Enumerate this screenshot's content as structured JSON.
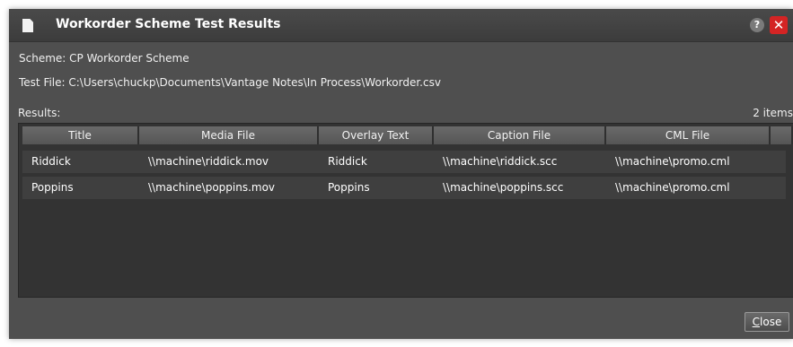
{
  "window": {
    "title": "Workorder Scheme Test Results",
    "help_icon": "?",
    "close_icon": "✕"
  },
  "info": {
    "scheme": "Scheme: CP Workorder Scheme",
    "test_file": "Test File: C:\\Users\\chuckp\\Documents\\Vantage Notes\\In Process\\Workorder.csv"
  },
  "results": {
    "label": "Results:",
    "count": "2 items",
    "columns": [
      "Title",
      "Media File",
      "Overlay Text",
      "Caption File",
      "CML File"
    ],
    "rows": [
      [
        "Riddick",
        "\\\\machine\\riddick.mov",
        "Riddick",
        "\\\\machine\\riddick.scc",
        "\\\\machine\\promo.cml"
      ],
      [
        "Poppins",
        "\\\\machine\\poppins.mov",
        "Poppins",
        "\\\\machine\\poppins.scc",
        "\\\\machine\\promo.cml"
      ]
    ]
  },
  "buttons": {
    "close_mnemonic": "C",
    "close_rest": "lose"
  },
  "colors": {
    "dialog_bg": "#4f4f4f",
    "grid_bg": "#333333",
    "close_red": "#d42424"
  }
}
